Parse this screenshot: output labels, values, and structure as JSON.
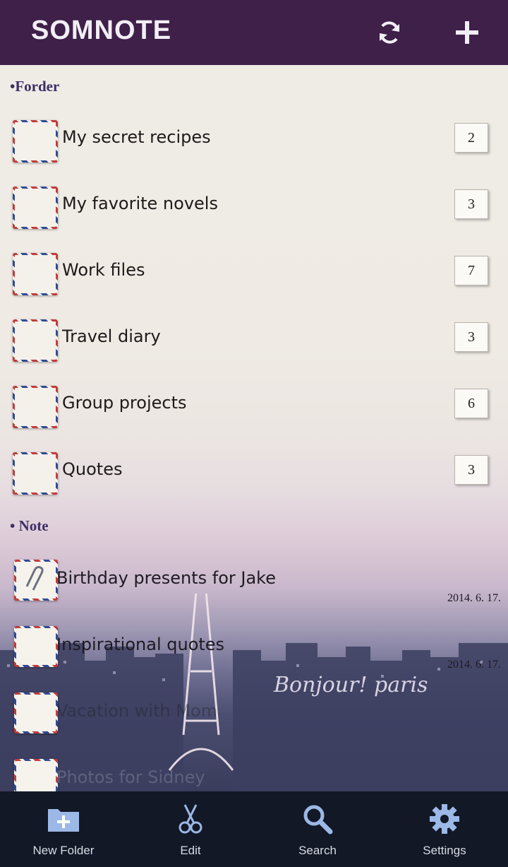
{
  "app": {
    "title": "SOMNOTE"
  },
  "header": {
    "sync_icon": "sync-icon",
    "add_icon": "plus-icon"
  },
  "folders": {
    "section_label": "•Forder",
    "items": [
      {
        "name": "My secret recipes",
        "count": "2",
        "icon": "airmail-stamp-icon"
      },
      {
        "name": "My favorite novels",
        "count": "3",
        "icon": "envelope-stamp-icon"
      },
      {
        "name": "Work files",
        "count": "7",
        "icon": "postmark-stamp-icon"
      },
      {
        "name": "Travel diary",
        "count": "3",
        "icon": "portrait-stamp-icon"
      },
      {
        "name": "Group projects",
        "count": "6",
        "icon": "building-stamp-icon"
      },
      {
        "name": "Quotes",
        "count": "3",
        "icon": "globe-stamp-icon"
      }
    ]
  },
  "notes": {
    "section_label": "• Note",
    "items": [
      {
        "title": "Birthday presents for Jake",
        "date": "2014. 6. 17.",
        "icon": "paperclip-icon"
      },
      {
        "title": "Inspirational quotes",
        "date": "2014. 6. 17.",
        "icon": "envelope-icon"
      },
      {
        "title": "Vacation with Mom",
        "date": "",
        "icon": "envelope-icon"
      },
      {
        "title": "Photos for Sidney",
        "date": "",
        "icon": "envelope-icon"
      }
    ]
  },
  "background": {
    "caption": "Bonjour! paris"
  },
  "bottom_nav": {
    "items": [
      {
        "label": "New Folder",
        "icon": "new-folder-icon"
      },
      {
        "label": "Edit",
        "icon": "scissors-icon"
      },
      {
        "label": "Search",
        "icon": "search-icon"
      },
      {
        "label": "Settings",
        "icon": "gear-icon"
      }
    ]
  },
  "colors": {
    "header_bg": "#3e2049",
    "nav_bg": "#121826",
    "section_text": "#3d2e66"
  }
}
